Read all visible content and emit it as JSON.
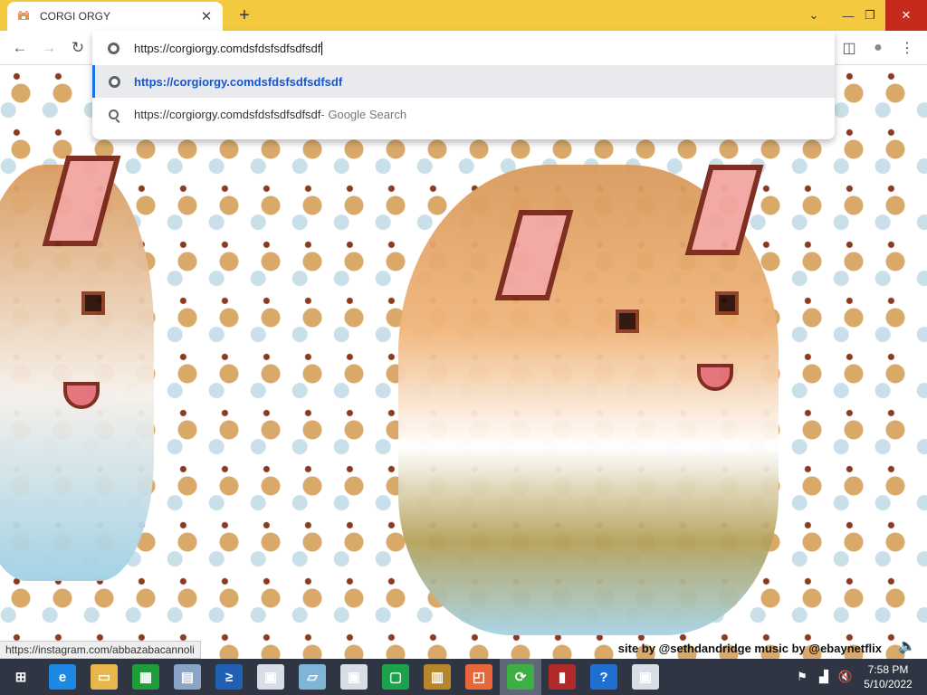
{
  "browser": {
    "tab": {
      "title": "CORGI ORGY",
      "close_glyph": "✕"
    },
    "new_tab_glyph": "+",
    "window_controls": {
      "dropdown": "⌄",
      "minimize": "—",
      "restore": "❐",
      "close": "✕"
    },
    "nav": {
      "back": "←",
      "forward": "→",
      "reload": "↻"
    },
    "toolbar_icons": {
      "sidepanel": "◫",
      "profile": "●",
      "menu": "⋮"
    }
  },
  "omnibox": {
    "input_value": "https://corgiorgy.comdsfdsfsdfsdfsdf",
    "suggestions": [
      {
        "icon": "globe-icon",
        "text": "https://corgiorgy.comdsfdsfsdfsdfsdf",
        "suffix": ""
      },
      {
        "icon": "search-icon",
        "text": "https://corgiorgy.comdsfdsfsdfsdfsdf",
        "suffix": " - Google Search"
      }
    ]
  },
  "page": {
    "credits": "site by @sethdandridge   music by @ebaynetflix",
    "speaker_glyph": "🔈",
    "status_url": "https://instagram.com/abbazabacannoli"
  },
  "taskbar": {
    "items": [
      {
        "name": "start-button",
        "glyph": "⊞",
        "color": "#2f3542"
      },
      {
        "name": "ie-icon",
        "glyph": "e",
        "color": "#1e88e5"
      },
      {
        "name": "explorer-icon",
        "glyph": "▭",
        "color": "#e8b64a"
      },
      {
        "name": "store-icon",
        "glyph": "▦",
        "color": "#1f9d3a"
      },
      {
        "name": "perfmon-icon",
        "glyph": "▤",
        "color": "#8aa4c8"
      },
      {
        "name": "powershell-icon",
        "glyph": "≥",
        "color": "#1f5fb4"
      },
      {
        "name": "window-app-icon",
        "glyph": "▣",
        "color": "#d8dde6"
      },
      {
        "name": "notepad-icon",
        "glyph": "▱",
        "color": "#7fb6d8"
      },
      {
        "name": "window-app-2-icon",
        "glyph": "▣",
        "color": "#d8dde6"
      },
      {
        "name": "terminal-icon",
        "glyph": "▢",
        "color": "#1aa34a"
      },
      {
        "name": "archive-icon",
        "glyph": "▥",
        "color": "#b8862a"
      },
      {
        "name": "twitch-icon",
        "glyph": "◰",
        "color": "#e8673a"
      },
      {
        "name": "sync-icon",
        "glyph": "⟳",
        "color": "#3cb043"
      },
      {
        "name": "reader-icon",
        "glyph": "▮",
        "color": "#b02a2a"
      },
      {
        "name": "help-icon",
        "glyph": "?",
        "color": "#1e6fd0"
      },
      {
        "name": "window-app-3-icon",
        "glyph": "▣",
        "color": "#d8dde6"
      }
    ],
    "tray": {
      "flag": "⚑",
      "network": "▟",
      "volume": "🔇"
    },
    "clock": {
      "time": "7:58 PM",
      "date": "5/10/2022"
    }
  }
}
